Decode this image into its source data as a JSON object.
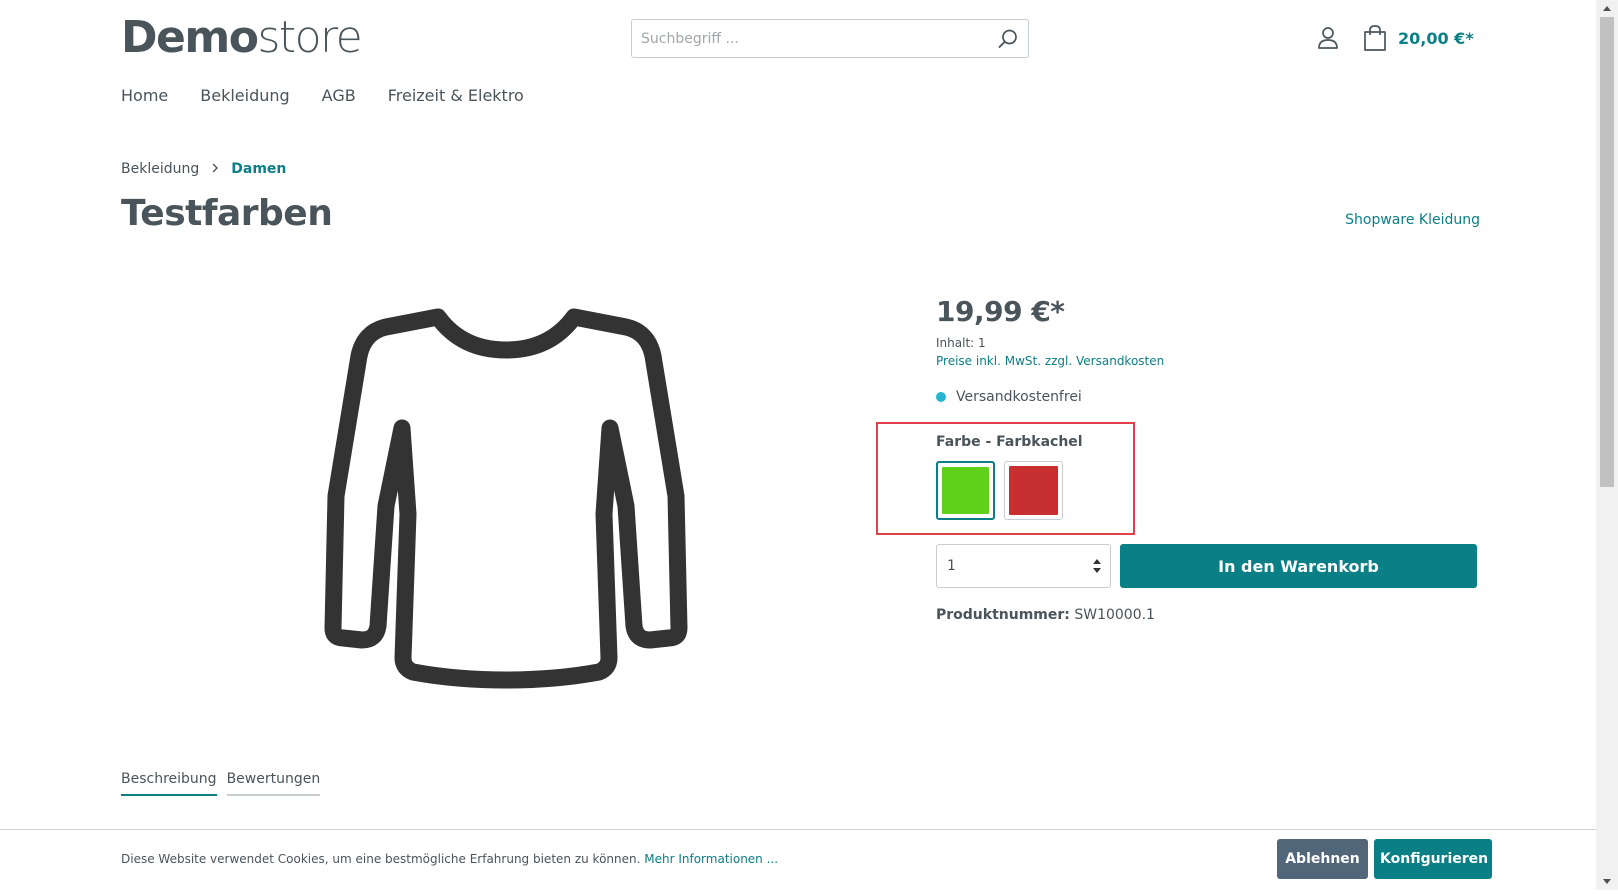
{
  "header": {
    "logo": {
      "bold": "Demo",
      "light": "store"
    },
    "search": {
      "placeholder": "Suchbegriff ..."
    },
    "cart": {
      "total": "20,00 €*"
    },
    "nav": [
      "Home",
      "Bekleidung",
      "AGB",
      "Freizeit & Elektro"
    ]
  },
  "breadcrumb": {
    "parent": "Bekleidung",
    "current": "Damen"
  },
  "product": {
    "title": "Testfarben",
    "manufacturer": "Shopware Kleidung",
    "price": "19,99 €*",
    "content": "Inhalt: 1",
    "tax_link": "Preise inkl. MwSt. zzgl. Versandkosten",
    "delivery": "Versandkostenfrei",
    "variant_group": "Farbe - Farbkachel",
    "swatches": [
      {
        "color": "#5fd11a",
        "selected": true
      },
      {
        "color": "#c72f30",
        "selected": false
      }
    ],
    "quantity": "1",
    "buy_label": "In den Warenkorb",
    "number_label": "Produktnummer:",
    "number_value": "SW10000.1"
  },
  "tabs": [
    "Beschreibung",
    "Bewertungen"
  ],
  "cookie": {
    "text": "Diese Website verwendet Cookies, um eine bestmögliche Erfahrung bieten zu können.",
    "link": "Mehr Informationen ...",
    "decline": "Ablehnen",
    "configure": "Konfigurieren"
  },
  "colors": {
    "accent": "#0b7f86",
    "text": "#4a545b",
    "highlight": "#e0404a",
    "decline_button": "#52667a",
    "delivery_dot": "#26b6cf"
  },
  "icons": {
    "search": "search-icon",
    "account": "user-icon",
    "cart": "shopping-bag-icon",
    "quantity": "sort-arrows-icon",
    "breadcrumb_separator": "chevron-right-icon",
    "product_image": "long-sleeve-shirt-icon"
  }
}
